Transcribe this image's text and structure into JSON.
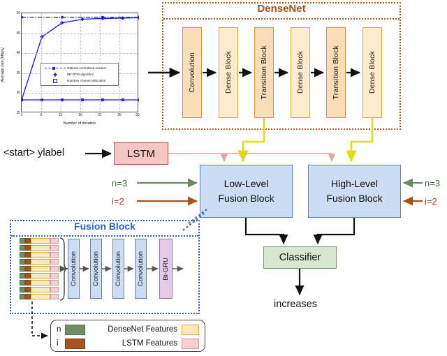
{
  "chart": {
    "ylabel": "Average rate [Mbps]",
    "xlabel": "Number of iteration",
    "yticks": [
      "25",
      "30",
      "35",
      "40",
      "45",
      "50"
    ],
    "xticks": [
      "1",
      "6",
      "11",
      "16",
      "21",
      "26",
      "30"
    ],
    "legend": [
      "Optimal centralized solution",
      "BR-DFM algorithm",
      "Random channel allocation"
    ]
  },
  "chart_data": {
    "type": "line",
    "title": "",
    "xlabel": "Number of iteration",
    "ylabel": "Average rate [Mbps]",
    "xlim": [
      1,
      30
    ],
    "ylim": [
      25,
      50
    ],
    "grid": true,
    "legend_position": "center",
    "x": [
      1,
      6,
      11,
      16,
      21,
      26,
      30
    ],
    "series": [
      {
        "name": "Optimal centralized solution",
        "style": "dash-dot",
        "color": "#2222dd",
        "values": [
          49,
          49,
          49,
          49,
          49,
          49,
          49
        ]
      },
      {
        "name": "BR-DFM algorithm",
        "style": "solid-marker-diamond",
        "color": "#2222dd",
        "values": [
          28.3,
          44.1,
          47.6,
          48.5,
          48.7,
          48.8,
          48.9
        ]
      },
      {
        "name": "Random channel allocation",
        "style": "solid-marker-square",
        "color": "#2222dd",
        "values": [
          28.3,
          28.3,
          28.3,
          28.3,
          28.3,
          28.3,
          28.3
        ]
      }
    ]
  },
  "densenet": {
    "title": "DenseNet",
    "blocks": [
      {
        "label": "Convolution",
        "kind": "conv"
      },
      {
        "label": "Dense Block",
        "kind": "dense"
      },
      {
        "label": "Transition Block",
        "kind": "trans"
      },
      {
        "label": "Dense Block",
        "kind": "dense"
      },
      {
        "label": "Transition Block",
        "kind": "trans"
      },
      {
        "label": "Dense Block",
        "kind": "dense"
      }
    ]
  },
  "caption": {
    "start_token": "<start> ylabel",
    "lstm": "LSTM"
  },
  "fusion": {
    "low_line1": "Low-Level",
    "low_line2": "Fusion Block",
    "high_line1": "High-Level",
    "high_line2": "Fusion Block",
    "n_value": "n=3",
    "i_value": "i=2"
  },
  "classifier": {
    "label": "Classifier",
    "output": "increases"
  },
  "fusion_block_detail": {
    "title": "Fusion Block",
    "blocks": [
      "Convolution",
      "Convolution",
      "Convolution",
      "Convolution",
      "Bi-GRU"
    ],
    "stack_rows": 9
  },
  "bottom_legend": {
    "n_key": "n",
    "i_key": "i",
    "densenet_features": "DenseNet Features",
    "lstm_features": "LSTM Features"
  },
  "colors": {
    "densenet_border": "#b5591c",
    "densenet_title": "#a8521b",
    "conv_fill": "#fbdcb8",
    "dense_fill": "#fdeccd",
    "lstm_fill": "#f5c6c4",
    "fusion_fill": "#ccdcf2",
    "classifier_fill": "#d8e8d0",
    "gru_fill": "#e2cbe6",
    "yellow_path": "#dede10",
    "pink_path": "#e8afae",
    "green_arrow": "#6a8a5f",
    "brown_arrow": "#a6531f",
    "blue_dotted": "#2c62c9",
    "chart_blue": "#2222dd"
  }
}
